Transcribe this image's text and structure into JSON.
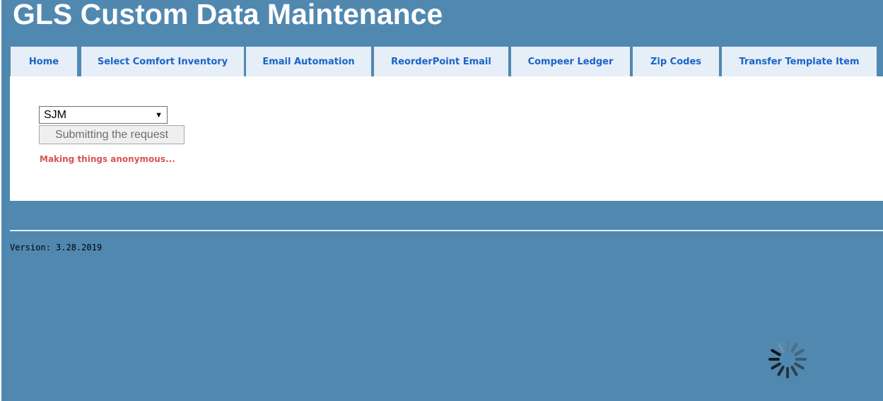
{
  "header": {
    "title": "GLS Custom Data Maintenance"
  },
  "nav": {
    "tabs": [
      {
        "label": "Home"
      },
      {
        "label": "Select Comfort Inventory"
      },
      {
        "label": "Email Automation"
      },
      {
        "label": "ReorderPoint Email"
      },
      {
        "label": "Compeer Ledger"
      },
      {
        "label": "Zip Codes"
      },
      {
        "label": "Transfer Template Item"
      }
    ]
  },
  "form": {
    "site_select": {
      "selected": "SJM"
    },
    "submit_label": "Submitting the request",
    "status_message": "Making things anonymous..."
  },
  "footer": {
    "version": "Version: 3.28.2019"
  },
  "icons": {
    "dropdown": "chevron-down-icon",
    "loading": "spinner-icon"
  },
  "colors": {
    "page_background": "#5088b0",
    "tab_background": "#e6eef7",
    "tab_text": "#1a64c8",
    "status_text": "#d9534f",
    "panel_background": "#ffffff"
  }
}
